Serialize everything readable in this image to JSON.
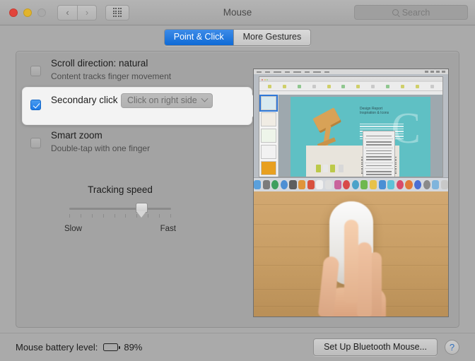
{
  "window": {
    "title": "Mouse",
    "traffic_lights": [
      "close",
      "minimize",
      "zoom-disabled"
    ],
    "nav_back_icon": "‹",
    "nav_forward_icon": "›",
    "grid_button_icon": "grid-view-icon"
  },
  "search": {
    "placeholder": "Search",
    "icon": "search-icon"
  },
  "tabs": [
    {
      "label": "Point & Click",
      "active": true
    },
    {
      "label": "More Gestures",
      "active": false
    }
  ],
  "options": [
    {
      "id": "scroll-direction",
      "title": "Scroll direction: natural",
      "subtitle": "Content tracks finger movement",
      "checked": false
    },
    {
      "id": "secondary-click",
      "title": "Secondary click",
      "subtitle": "",
      "checked": true,
      "highlighted": true,
      "popup_value": "Click on right side",
      "popup_icon": "chevron-down-icon"
    },
    {
      "id": "smart-zoom",
      "title": "Smart zoom",
      "subtitle": "Double-tap with one finger",
      "checked": false
    }
  ],
  "tracking_speed": {
    "title": "Tracking speed",
    "min_label": "Slow",
    "max_label": "Fast",
    "ticks": 10,
    "value_percent": 80
  },
  "preview": {
    "name": "secondary-click-demo-video",
    "top_scene": "macos-desktop-pages-context-menu",
    "bottom_scene": "hand-right-clicking-magic-mouse-on-wooden-desk"
  },
  "bottom_bar": {
    "battery_label": "Mouse battery level:",
    "battery_icon": "battery-icon",
    "battery_percent": "89%",
    "setup_button": "Set Up Bluetooth Mouse...",
    "help_button": "?"
  },
  "colors": {
    "accent_blue": "#1c7ae8",
    "tab_active": "#1d78e0",
    "window_bg": "#aaaaaa",
    "panel_bg": "#a3a3a3",
    "callout_bg": "#f3f3f3",
    "help_blue": "#2f6fbf"
  }
}
